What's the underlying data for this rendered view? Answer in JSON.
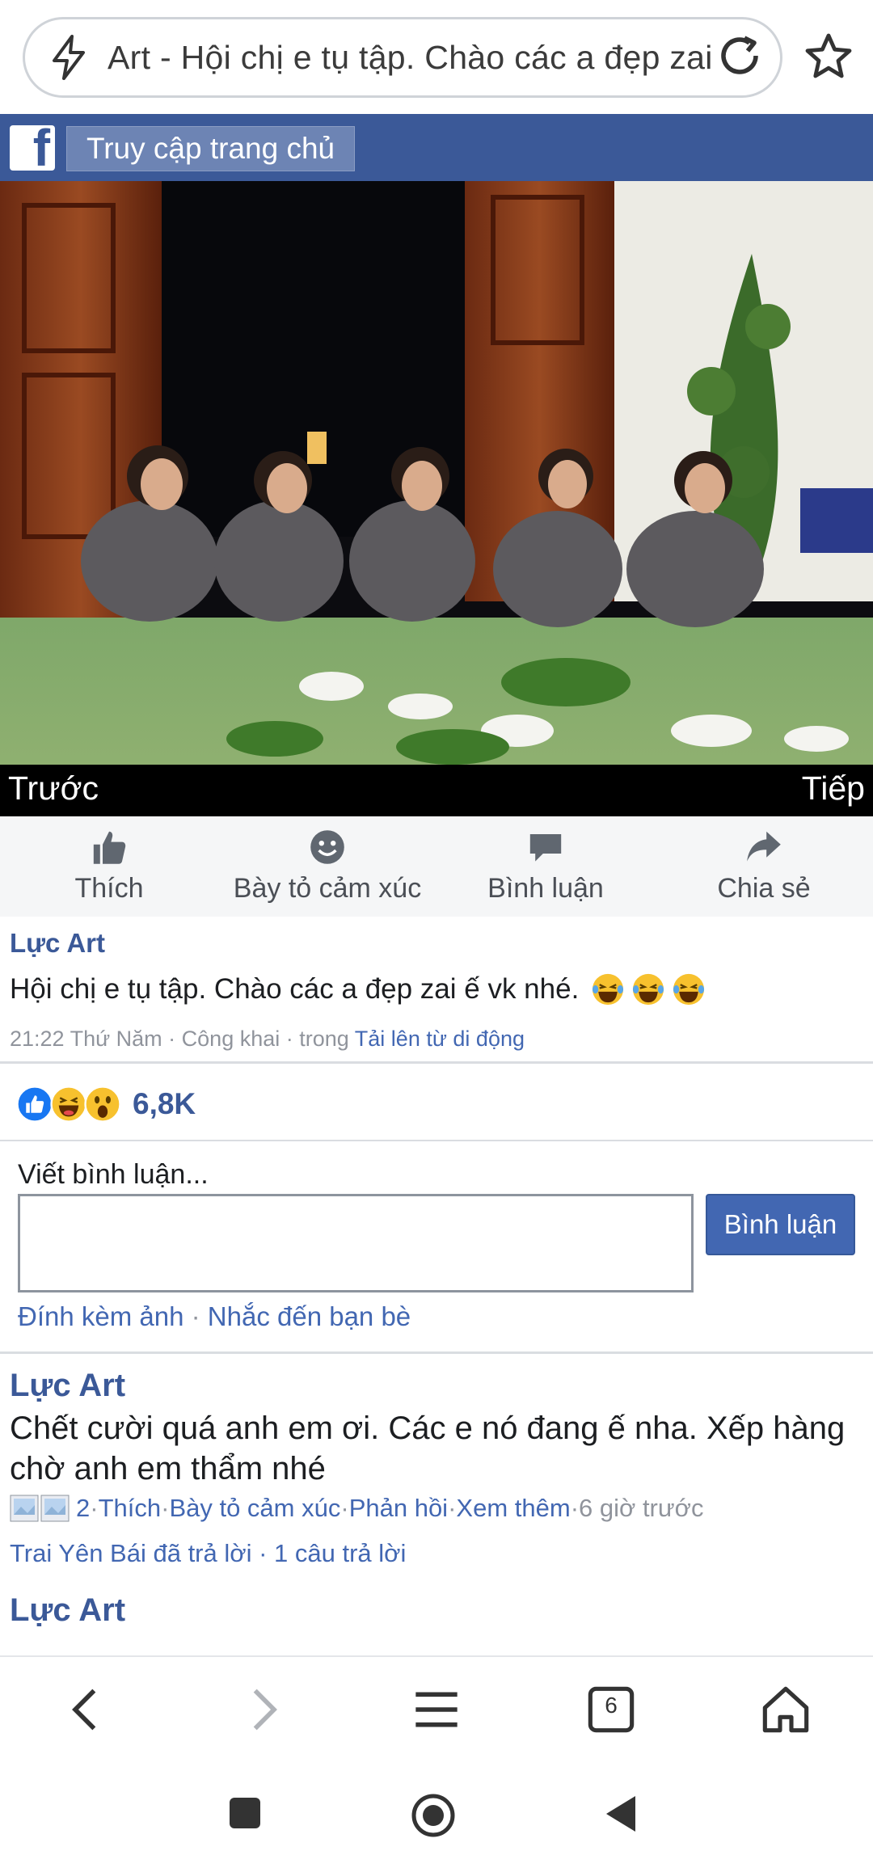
{
  "browser": {
    "url_text": "Art - Hội chị e tụ tập. Chào các a đẹp zai ế vk nhé.",
    "icons": {
      "left": "bolt-icon",
      "reload": "reload-icon",
      "bookmark": "star-icon"
    }
  },
  "fb_header": {
    "logo_letter": "f",
    "home_label": "Truy cập trang chủ",
    "brand_color": "#3b5998"
  },
  "photo_nav": {
    "prev": "Trước",
    "next": "Tiếp"
  },
  "actions": [
    {
      "label": "Thích",
      "icon": "thumbs-up-icon"
    },
    {
      "label": "Bày tỏ cảm xúc",
      "icon": "smiley-icon"
    },
    {
      "label": "Bình luận",
      "icon": "comment-icon"
    },
    {
      "label": "Chia sẻ",
      "icon": "share-arrow-icon"
    }
  ],
  "post": {
    "author": "Lực Art",
    "text": "Hội chị e tụ tập. Chào các a đẹp zai ế vk nhé.",
    "emojis": [
      "laughing-tears-emoji",
      "laughing-tears-emoji",
      "laughing-tears-emoji"
    ],
    "meta_prefix": "21:22 Thứ Năm · Công khai · trong ",
    "meta_link": "Tải lên từ di động"
  },
  "reactions": {
    "types": [
      "like",
      "haha",
      "wow"
    ],
    "count": "6,8K"
  },
  "comment_form": {
    "label": "Viết bình luận...",
    "button": "Bình luận",
    "attach": "Đính kèm ảnh",
    "sep": " · ",
    "mention": "Nhắc đến bạn bè"
  },
  "comments": [
    {
      "author": "Lực Art",
      "text": "Chết cười quá anh em ơi. Các e nó đang ế nha. Xếp hàng chờ anh em thẩm nhé",
      "reaction_count": "2",
      "like": "Thích",
      "react": "Bày tỏ cảm xúc",
      "reply": "Phản hồi",
      "more": "Xem thêm",
      "time": "6 giờ trước",
      "sep": " · ",
      "replies_who": "Trai Yên Bái đã trả lời",
      "replies_count": "1 câu trả lời"
    },
    {
      "author": "Lực Art"
    }
  ],
  "toolbar": {
    "tab_count": "6"
  }
}
